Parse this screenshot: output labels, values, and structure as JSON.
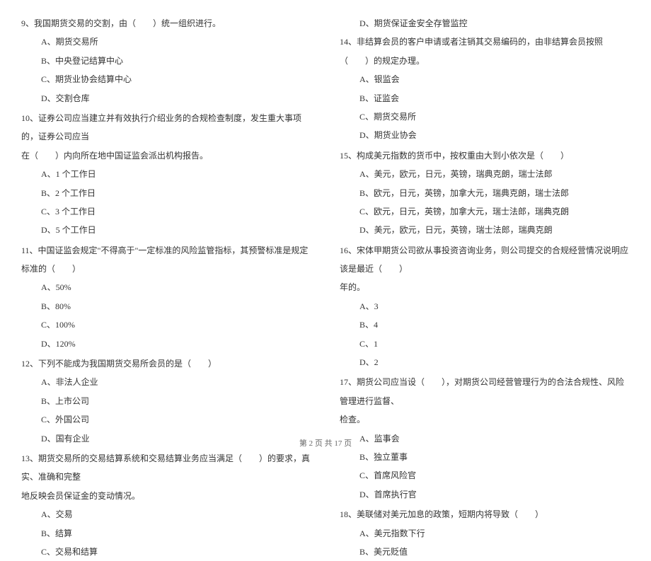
{
  "left": {
    "q9": {
      "text": "9、我国期货交易的交割，由（　　）统一组织进行。",
      "a": "A、期货交易所",
      "b": "B、中央登记结算中心",
      "c": "C、期货业协会结算中心",
      "d": "D、交割仓库"
    },
    "q10": {
      "text1": "10、证券公司应当建立并有效执行介绍业务的合规检查制度，发生重大事项的，证券公司应当",
      "text2": "在（　　）内向所在地中国证监会派出机构报告。",
      "a": "A、1 个工作日",
      "b": "B、2 个工作日",
      "c": "C、3 个工作日",
      "d": "D、5 个工作日"
    },
    "q11": {
      "text": "11、中国证监会规定\"不得高于\"一定标准的风险监管指标，其预警标准是规定标准的（　　）",
      "a": "A、50%",
      "b": "B、80%",
      "c": "C、100%",
      "d": "D、120%"
    },
    "q12": {
      "text": "12、下列不能成为我国期货交易所会员的是（　　）",
      "a": "A、非法人企业",
      "b": "B、上市公司",
      "c": "C、外国公司",
      "d": "D、国有企业"
    },
    "q13": {
      "text1": "13、期货交易所的交易结算系统和交易结算业务应当满足（　　）的要求，真实、准确和完整",
      "text2": "地反映会员保证金的变动情况。",
      "a": "A、交易",
      "b": "B、结算",
      "c": "C、交易和结算"
    }
  },
  "right": {
    "q13d": "D、期货保证金安全存管监控",
    "q14": {
      "text": "14、非结算会员的客户申请或者注销其交易编码的，由非结算会员按照（　　）的规定办理。",
      "a": "A、银监会",
      "b": "B、证监会",
      "c": "C、期货交易所",
      "d": "D、期货业协会"
    },
    "q15": {
      "text": "15、构成美元指数的货币中，按权重由大到小依次是（　　）",
      "a": "A、美元，欧元，日元，英镑，瑞典克朗，瑞士法郎",
      "b": "B、欧元，日元，英镑，加拿大元，瑞典克朗，瑞士法郎",
      "c": "C、欧元，日元，英镑，加拿大元，瑞士法郎，瑞典克朗",
      "d": "D、美元，欧元，日元，英镑，瑞士法郎，瑞典克朗"
    },
    "q16": {
      "text1": "16、宋体甲期货公司欲从事投资咨询业务，则公司提交的合规经营情况说明应该是最近（　　）",
      "text2": "年的。",
      "a": "A、3",
      "b": "B、4",
      "c": "C、1",
      "d": "D、2"
    },
    "q17": {
      "text1": "17、期货公司应当设（　　），对期货公司经营管理行为的合法合规性、风险管理进行监督、",
      "text2": "检查。",
      "a": "A、监事会",
      "b": "B、独立董事",
      "c": "C、首席风险官",
      "d": "D、首席执行官"
    },
    "q18": {
      "text": "18、美联储对美元加息的政策，短期内将导致（　　）",
      "a": "A、美元指数下行",
      "b": "B、美元贬值"
    }
  },
  "footer": "第 2 页 共 17 页"
}
